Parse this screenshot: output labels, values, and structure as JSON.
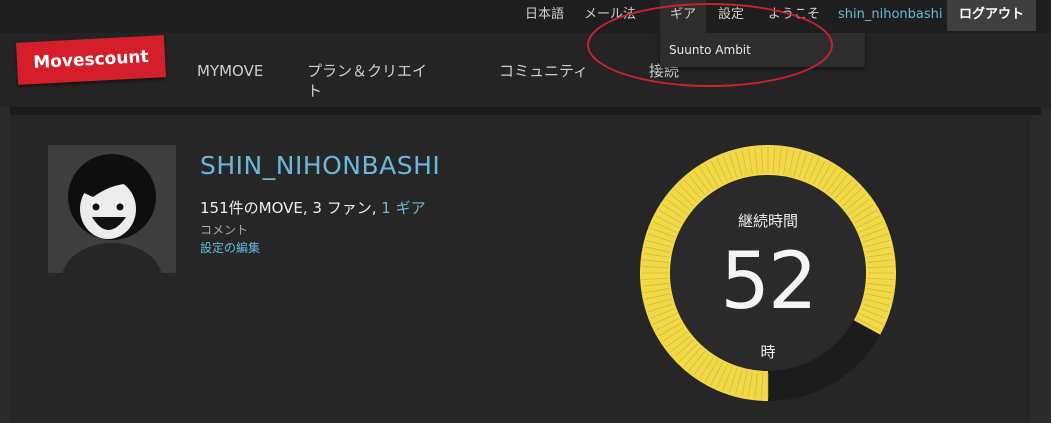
{
  "topbar": {
    "language": "日本語",
    "email_method": "メール法",
    "gear": "ギア",
    "settings": "設定",
    "welcome": "ようこそ",
    "username": "shin_nihonbashi",
    "logout": "ログアウト"
  },
  "gear_dropdown": {
    "items": [
      "Suunto Ambit"
    ]
  },
  "logo": {
    "text": "Movescount"
  },
  "nav": {
    "items": [
      {
        "label": "MYMOVE"
      },
      {
        "label_line1": "プラン＆クリエイ",
        "label_line2": "ト"
      },
      {
        "label": "コミュニティ"
      },
      {
        "label": "接続"
      }
    ]
  },
  "profile": {
    "name": "SHIN_NIHONBASHI",
    "moves_count_text": "151件のMOVE,",
    "fans_text": "3 ファン,",
    "gear_link": "1 ギア",
    "comment_label": "コメント",
    "edit_settings": "設定の編集"
  },
  "duration_gauge": {
    "title": "継続時間",
    "value": "52",
    "unit": "時",
    "fill_fraction": 0.83
  },
  "colors": {
    "accent_blue": "#6ab8db",
    "brand_red": "#d41f2a",
    "gauge_yellow": "#f2d948",
    "annotation_red": "#c8242c"
  }
}
